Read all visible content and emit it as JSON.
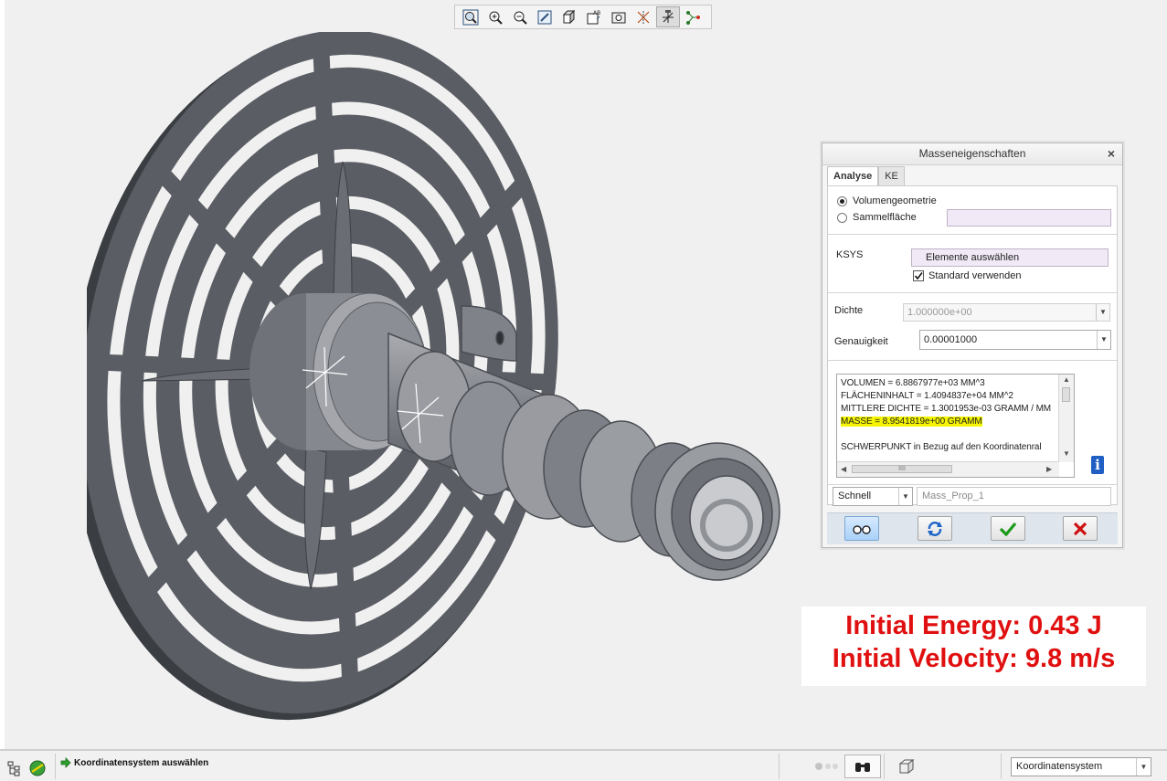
{
  "toolbar": {
    "buttons": [
      "zoom-fit-icon",
      "zoom-in-icon",
      "zoom-out-icon",
      "repaint-icon",
      "display-style-icon",
      "saved-views-icon",
      "view-manager-icon",
      "datum-display-icon",
      "spin-center-icon",
      "annotation-display-icon"
    ],
    "active": "spin-center-icon"
  },
  "dialog": {
    "title": "Masseneigenschaften",
    "close": "×",
    "tabs": [
      "Analyse",
      "KE"
    ],
    "radio_volume": "Volumengeometrie",
    "radio_quilt": "Sammelfläche",
    "ksys_label": "KSYS",
    "ksys_field": "Elemente auswählen",
    "use_default": "Standard verwenden",
    "density_label": "Dichte",
    "density_value": "1.000000e+00",
    "accuracy_label": "Genauigkeit",
    "accuracy_value": "0.00001000",
    "results": [
      "VOLUMEN =  6.8867977e+03  MM^3",
      "FLÄCHENINHALT =  1.4094837e+04  MM^2",
      "MITTLERE DICHTE =  1.3001953e-03 GRAMM / MM",
      "MASSE =  8.9541819e+00 GRAMM",
      "",
      "SCHWERPUNKT in Bezug auf den Koordinatenral"
    ],
    "hscroll_grip": "IIII",
    "mode_value": "Schnell",
    "name_value": "Mass_Prop_1",
    "buttons": [
      "preview-icon",
      "repeat-icon",
      "ok-icon",
      "cancel-icon"
    ],
    "colors": {
      "ok": "#1a9a1a",
      "cancel": "#d01010",
      "highlight": "#f5f500",
      "info": "#1f5fc4"
    }
  },
  "overlay": {
    "energy": "Initial Energy: 0.43 J",
    "velocity": "Initial Velocity: 9.8 m/s",
    "color": "#e01010"
  },
  "status": {
    "message": "Koordinatensystem auswählen",
    "filter_value": "Koordinatensystem"
  }
}
